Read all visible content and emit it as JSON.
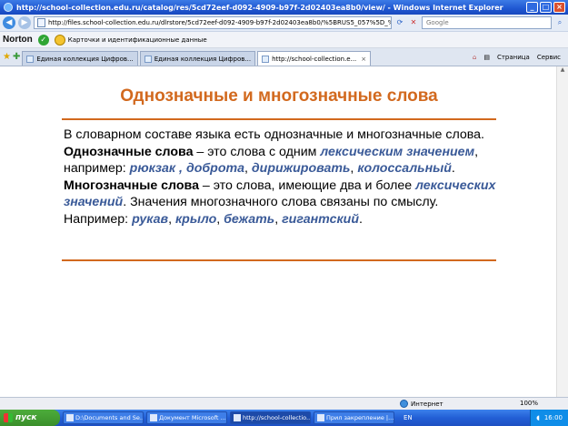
{
  "window": {
    "title": "http://school-collection.edu.ru/catalog/res/5cd72eef-d092-4909-b97f-2d02403ea8b0/view/ - Windows Internet Explorer",
    "buttons": [
      "_",
      "□",
      "×"
    ]
  },
  "addressbar": {
    "url": "http://files.school-collection.edu.ru/dlrstore/5cd72eef-d092-4909-b97f-2d02403ea8b0/%5BRUS5_057%5D_%5BTD_008%",
    "search_placeholder": "Google"
  },
  "norton": {
    "brand": "Norton",
    "cards_label": "Карточки и идентификационные данные"
  },
  "tabs": [
    {
      "label": "Единая коллекция Цифров...",
      "active": false
    },
    {
      "label": "Единая коллекция Цифров...",
      "active": false
    },
    {
      "label": "http://school-collection.e...",
      "active": true
    }
  ],
  "toolbar_right": {
    "page_label": "Страница",
    "service_label": "Сервис"
  },
  "content": {
    "heading": "Однозначные и многозначные слова",
    "p1": "В словарном составе языка есть однозначные и многозначные слова.",
    "p2_bold": "Однозначные слова",
    "p2_text1": " – это слова с одним ",
    "p2_term": "лексическим значением",
    "p2_text2": ", например: ",
    "p2_ex1": "рюкзак",
    "p2_sep1": " , ",
    "p2_ex2": "доброта",
    "p2_sep2": ", ",
    "p2_ex3": "дирижировать",
    "p2_sep3": ", ",
    "p2_ex4": "колоссальный",
    "p2_end": ".",
    "p3_bold": "Многозначные слова",
    "p3_text1": " – это слова, имеющие два и более ",
    "p3_term": "лексических значений",
    "p3_text2": ". Значения многозначного слова связаны по смыслу. Например: ",
    "p3_ex1": "рукав",
    "p3_sep1": ", ",
    "p3_ex2": "крыло",
    "p3_sep2": ", ",
    "p3_ex3": "бежать",
    "p3_sep3": ", ",
    "p3_ex4": "гигантский",
    "p3_end": "."
  },
  "statusbar": {
    "zone": "Интернет",
    "zoom": "100%"
  },
  "taskbar": {
    "start": "пуск",
    "tasks": [
      {
        "label": "D:\\Documents and Se...",
        "active": false
      },
      {
        "label": "Документ Microsoft ...",
        "active": false
      },
      {
        "label": "http://school-collectio...",
        "active": true
      },
      {
        "label": "Прил закрепление |...",
        "active": false
      }
    ],
    "lang": "EN",
    "clock": "16:00"
  }
}
